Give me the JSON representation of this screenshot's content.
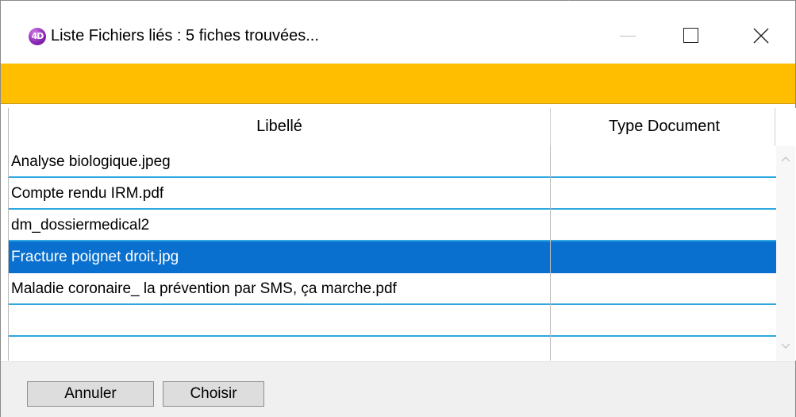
{
  "window": {
    "app_icon_text": "4D",
    "title": "Liste Fichiers liés : 5 fiches trouvées..."
  },
  "icons": {
    "app": "4d-app-icon",
    "minimize": "minimize-icon",
    "maximize": "maximize-icon",
    "close": "close-icon",
    "scroll_up": "chevron-up-icon",
    "scroll_down": "chevron-down-icon"
  },
  "colors": {
    "banner": "#ffbe00",
    "selection": "#0a70cf",
    "row_rule": "#2ea8e0"
  },
  "table": {
    "columns": [
      "Libellé",
      "Type Document"
    ],
    "rows": [
      {
        "libelle": "Analyse biologique.jpeg",
        "type": "",
        "selected": false
      },
      {
        "libelle": "Compte rendu IRM.pdf",
        "type": "",
        "selected": false
      },
      {
        "libelle": "dm_dossiermedical2",
        "type": "",
        "selected": false
      },
      {
        "libelle": "Fracture poignet droit.jpg",
        "type": "",
        "selected": true
      },
      {
        "libelle": "Maladie coronaire_ la prévention par SMS, ça marche.pdf",
        "type": "",
        "selected": false
      },
      {
        "libelle": "",
        "type": "",
        "selected": false
      },
      {
        "libelle": "",
        "type": "",
        "selected": false
      }
    ]
  },
  "buttons": {
    "cancel": "Annuler",
    "choose": "Choisir"
  }
}
